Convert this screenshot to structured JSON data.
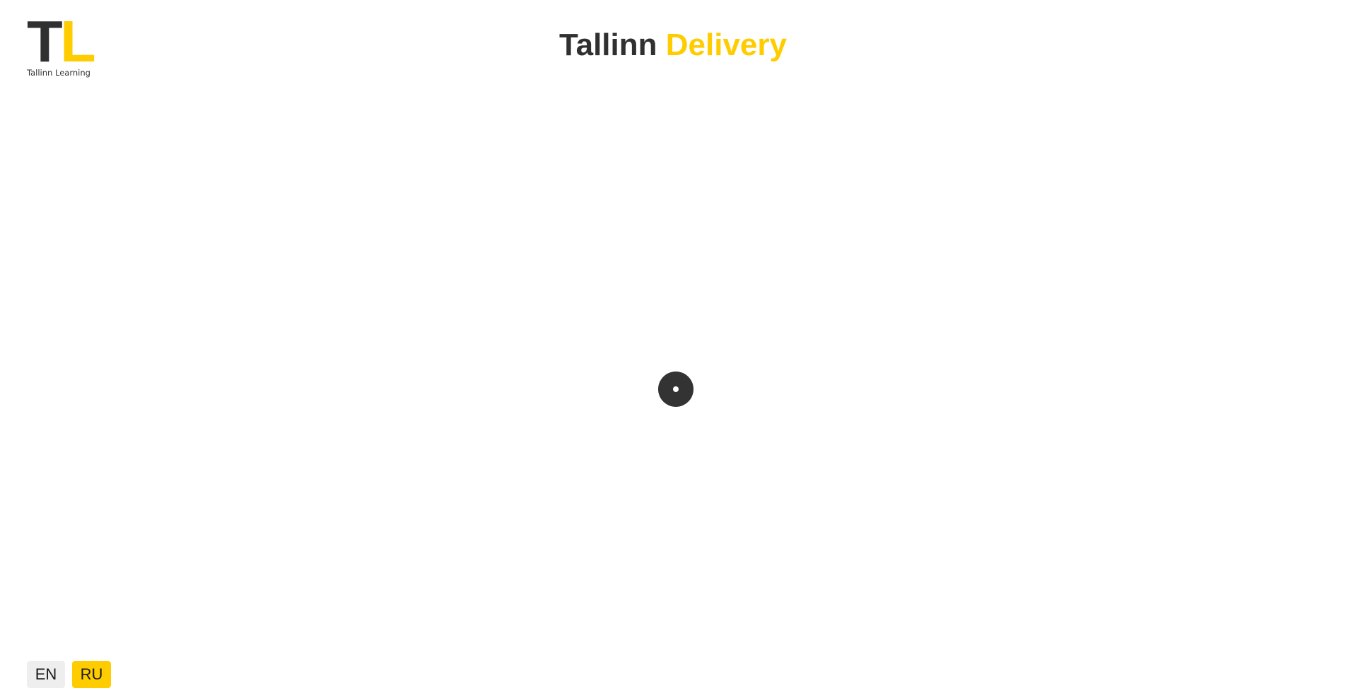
{
  "logo": {
    "letter_t": "T",
    "letter_l": "L",
    "caption": "Tallinn Learning"
  },
  "header": {
    "title_part1": "Tallinn",
    "title_part2": "Delivery"
  },
  "loader": {
    "icon": "loading-spinner-icon"
  },
  "language_switcher": {
    "options": [
      {
        "label": "EN"
      },
      {
        "label": "RU"
      }
    ],
    "selected": "RU"
  },
  "colors": {
    "brand_dark": "#303030",
    "brand_accent": "#ffcc00",
    "inactive_button": "#eeeeee"
  }
}
